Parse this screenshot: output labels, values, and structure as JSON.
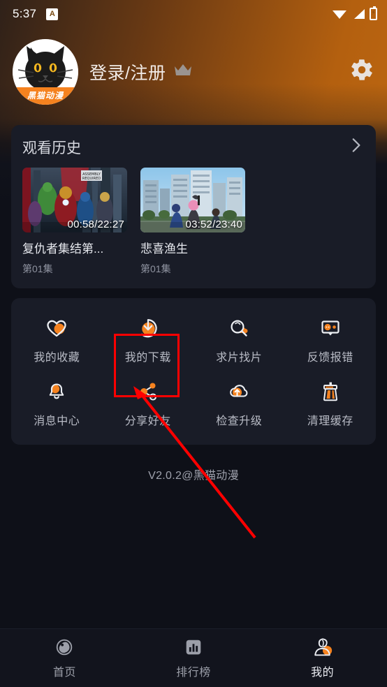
{
  "status_bar": {
    "time": "5:37",
    "notify_badge": "A",
    "icons": [
      "wifi-icon",
      "signal-icon",
      "battery-charging-icon"
    ]
  },
  "profile": {
    "avatar_brand": "黑猫动漫",
    "login_label": "登录/注册",
    "crown_icon": "crown-icon",
    "settings_icon": "gear-icon"
  },
  "history": {
    "title": "观看历史",
    "more_icon": "chevron-right-icon",
    "items": [
      {
        "title": "复仇者集结第...",
        "episode": "第01集",
        "time": "00:58/22:27"
      },
      {
        "title": "悲喜渔生",
        "episode": "第01集",
        "time": "03:52/23:40"
      }
    ]
  },
  "menu": {
    "rows": [
      [
        {
          "label": "我的收藏",
          "icon": "heart-icon"
        },
        {
          "label": "我的下载",
          "icon": "download-icon"
        },
        {
          "label": "求片找片",
          "icon": "search-request-icon"
        },
        {
          "label": "反馈报错",
          "icon": "feedback-icon"
        }
      ],
      [
        {
          "label": "消息中心",
          "icon": "bell-icon"
        },
        {
          "label": "分享好友",
          "icon": "share-icon"
        },
        {
          "label": "检查升级",
          "icon": "cloud-upload-icon"
        },
        {
          "label": "清理缓存",
          "icon": "broom-icon"
        }
      ]
    ]
  },
  "version_text": "V2.0.2@黑猫动漫",
  "bottom_nav": {
    "items": [
      {
        "label": "首页",
        "icon": "home-cat-icon",
        "active": false
      },
      {
        "label": "排行榜",
        "icon": "chart-rank-icon",
        "active": false
      },
      {
        "label": "我的",
        "icon": "user-profile-icon",
        "active": true
      }
    ]
  },
  "annotation": {
    "highlight_target": "我的下载",
    "box_color": "#ff0000",
    "arrow_color": "#ff0000"
  },
  "colors": {
    "accent_orange": "#f5821f",
    "card_bg": "#191c27",
    "page_bg": "#0d0f17",
    "text_primary": "#e6e8ee",
    "text_secondary": "#8f93a0"
  }
}
